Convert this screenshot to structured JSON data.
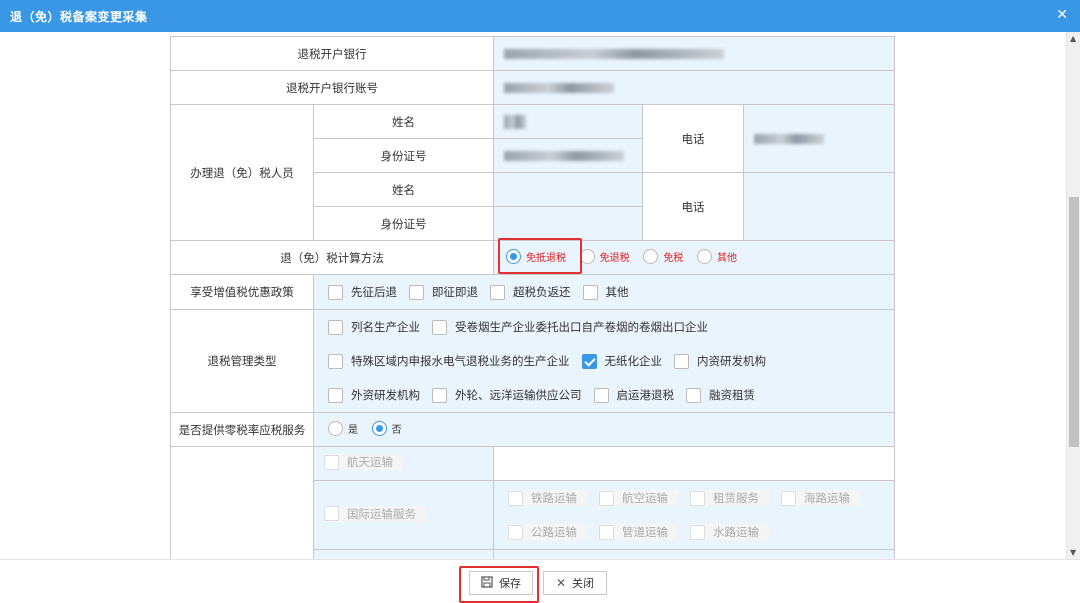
{
  "window": {
    "title": "退（免）税备案变更采集",
    "close_glyph": "✕"
  },
  "form": {
    "bank_label": "退税开户银行",
    "bank_account_label": "退税开户银行账号",
    "agent_label": "办理退（免）税人员",
    "name_label": "姓名",
    "id_label": "身份证号",
    "phone_label": "电话",
    "calc_method_label": "退（免）税计算方法",
    "calc_methods": [
      "免抵退税",
      "免退税",
      "免税",
      "其他"
    ],
    "vat_policy_label": "享受增值税优惠政策",
    "vat_policies": [
      "先征后退",
      "即征即退",
      "超税负返还",
      "其他"
    ],
    "mgmt_type_label": "退税管理类型",
    "mgmt_types_row1": [
      "列名生产企业",
      "受卷烟生产企业委托出口自产卷烟的卷烟出口企业"
    ],
    "mgmt_types_row2": [
      "特殊区域内申报水电气退税业务的生产企业",
      "无纸化企业",
      "内资研发机构"
    ],
    "mgmt_types_row3": [
      "外资研发机构",
      "外轮、远洋运输供应公司",
      "启运港退税",
      "融资租赁"
    ],
    "zero_rate_label": "是否提供零税率应税服务",
    "zero_rate_options": [
      "是",
      "否"
    ],
    "aerospace": "航天运输",
    "intl_transport": "国际运输服务",
    "transport_row1": [
      "铁路运输",
      "航空运输",
      "租赁服务",
      "海路运输"
    ],
    "transport_row2": [
      "公路运输",
      "管道运输",
      "水路运输"
    ]
  },
  "footer": {
    "save_label": "保存",
    "close_label": "关闭"
  }
}
